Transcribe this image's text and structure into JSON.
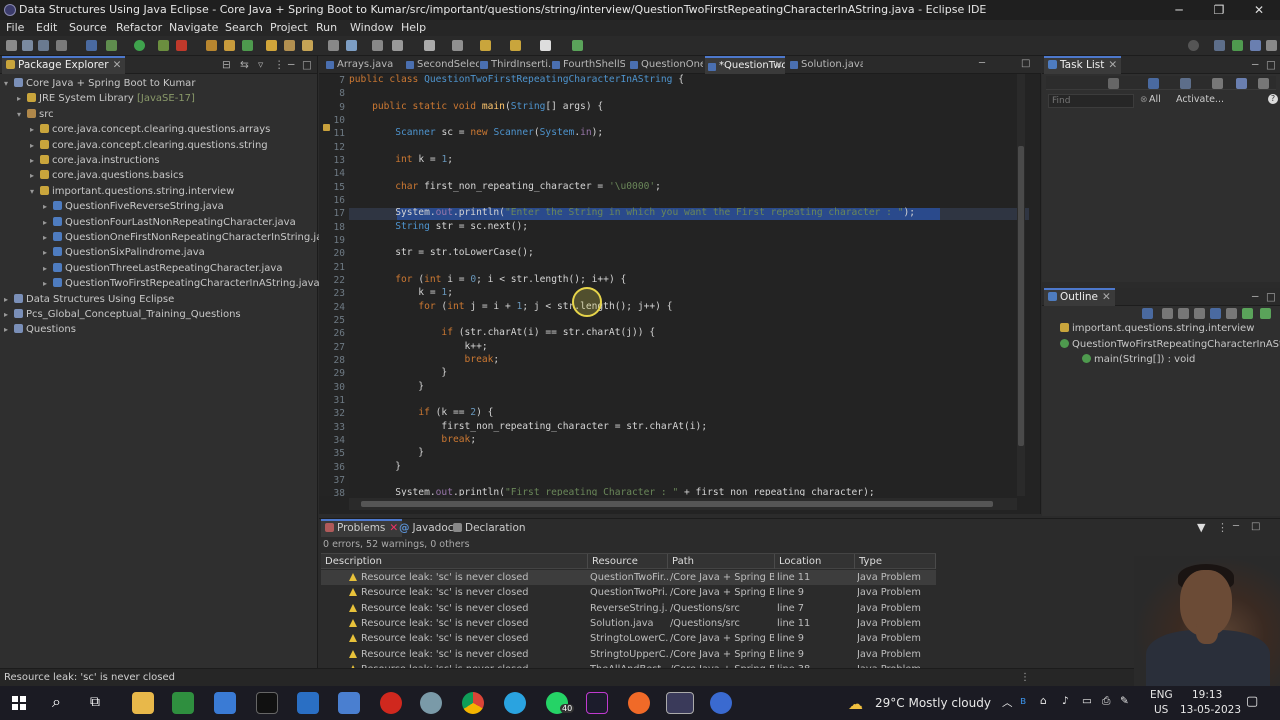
{
  "window": {
    "title": "Data Structures Using Java  Eclipse - Core Java + Spring Boot to Kumar/src/important/questions/string/interview/QuestionTwoFirstRepeatingCharacterInAString.java - Eclipse IDE",
    "minimize": "─",
    "maximize": "❐",
    "close": "✕"
  },
  "menu": [
    "File",
    "Edit",
    "Source",
    "Refactor",
    "Navigate",
    "Search",
    "Project",
    "Run",
    "Window",
    "Help"
  ],
  "package_explorer": {
    "tab_label": "Package Explorer",
    "tree": [
      {
        "label": "Core Java + Spring Boot to Kumar",
        "indent": 0,
        "twisty": "▾",
        "icon": "project-icon"
      },
      {
        "label": "JRE System Library",
        "suffix": " [JavaSE-17]",
        "indent": 1,
        "twisty": "▸",
        "icon": "library-icon"
      },
      {
        "label": "src",
        "indent": 1,
        "twisty": "▾",
        "icon": "source-folder-icon"
      },
      {
        "label": "core.java.concept.clearing.questions.arrays",
        "indent": 2,
        "twisty": "▸",
        "icon": "package-icon"
      },
      {
        "label": "core.java.concept.clearing.questions.string",
        "indent": 2,
        "twisty": "▸",
        "icon": "package-icon"
      },
      {
        "label": "core.java.instructions",
        "indent": 2,
        "twisty": "▸",
        "icon": "package-icon"
      },
      {
        "label": "core.java.questions.basics",
        "indent": 2,
        "twisty": "▸",
        "icon": "package-icon"
      },
      {
        "label": "important.questions.string.interview",
        "indent": 2,
        "twisty": "▾",
        "icon": "package-icon"
      },
      {
        "label": "QuestionFiveReverseString.java",
        "indent": 3,
        "twisty": "▸",
        "icon": "java-file-icon"
      },
      {
        "label": "QuestionFourLastNonRepeatingCharacter.java",
        "indent": 3,
        "twisty": "▸",
        "icon": "java-file-icon"
      },
      {
        "label": "QuestionOneFirstNonRepeatingCharacterInString.java",
        "indent": 3,
        "twisty": "▸",
        "icon": "java-file-icon"
      },
      {
        "label": "QuestionSixPalindrome.java",
        "indent": 3,
        "twisty": "▸",
        "icon": "java-file-icon"
      },
      {
        "label": "QuestionThreeLastRepeatingCharacter.java",
        "indent": 3,
        "twisty": "▸",
        "icon": "java-file-icon"
      },
      {
        "label": "QuestionTwoFirstRepeatingCharacterInAString.java",
        "indent": 3,
        "twisty": "▸",
        "icon": "java-file-icon"
      },
      {
        "label": "Data Structures Using Eclipse",
        "indent": 0,
        "twisty": "▸",
        "icon": "project-icon"
      },
      {
        "label": "Pcs_Global_Conceptual_Training_Questions",
        "indent": 0,
        "twisty": "▸",
        "icon": "project-icon"
      },
      {
        "label": "Questions",
        "indent": 0,
        "twisty": "▸",
        "icon": "project-icon"
      }
    ]
  },
  "editor": {
    "tabs": [
      "Arrays.java",
      "SecondSelec...",
      "ThirdInserti...",
      "FourthShellS...",
      "QuestionOne...",
      "*QuestionTwo...",
      "Solution.java"
    ],
    "active_tab": 5,
    "line_numbers": [
      "7",
      "8",
      "9",
      "10",
      "11",
      "12",
      "13",
      "14",
      "15",
      "16",
      "17",
      "18",
      "19",
      "20",
      "21",
      "22",
      "23",
      "24",
      "25",
      "26",
      "27",
      "28",
      "29",
      "30",
      "31",
      "32",
      "33",
      "34",
      "35",
      "36",
      "37",
      "38"
    ],
    "code": [
      {
        "parts": [
          [
            "kw",
            "public class "
          ],
          [
            "cls",
            "QuestionTwoFirstRepeatingCharacterInAString"
          ],
          [
            "var",
            " {"
          ]
        ]
      },
      {
        "parts": []
      },
      {
        "parts": [
          [
            "var",
            "    "
          ],
          [
            "kw",
            "public static void "
          ],
          [
            "mth",
            "main"
          ],
          [
            "var",
            "("
          ],
          [
            "cls",
            "String"
          ],
          [
            "var",
            "[] args) {"
          ]
        ]
      },
      {
        "parts": []
      },
      {
        "parts": [
          [
            "var",
            "        "
          ],
          [
            "cls",
            "Scanner "
          ],
          [
            "var",
            "sc = "
          ],
          [
            "kw",
            "new "
          ],
          [
            "cls",
            "Scanner"
          ],
          [
            "var",
            "("
          ],
          [
            "cls",
            "System"
          ],
          [
            "var",
            "."
          ],
          [
            "fld",
            "in"
          ],
          [
            "var",
            ");"
          ]
        ]
      },
      {
        "parts": []
      },
      {
        "parts": [
          [
            "var",
            "        "
          ],
          [
            "kw",
            "int "
          ],
          [
            "var",
            "k = "
          ],
          [
            "num",
            "1"
          ],
          [
            "var",
            ";"
          ]
        ]
      },
      {
        "parts": []
      },
      {
        "parts": [
          [
            "var",
            "        "
          ],
          [
            "kw",
            "char "
          ],
          [
            "var",
            "first_non_repeating_character = "
          ],
          [
            "str",
            "'\\u0000'"
          ],
          [
            "var",
            ";"
          ]
        ]
      },
      {
        "parts": []
      },
      {
        "parts": [
          [
            "var",
            "        System."
          ],
          [
            "fld",
            "out"
          ],
          [
            "var",
            ".println("
          ],
          [
            "str",
            "\"Enter the String in which you want the First repeating character : \""
          ],
          [
            "var",
            ");"
          ]
        ]
      },
      {
        "parts": [
          [
            "var",
            "        "
          ],
          [
            "cls",
            "String "
          ],
          [
            "var",
            "str = sc.next();"
          ]
        ]
      },
      {
        "parts": []
      },
      {
        "parts": [
          [
            "var",
            "        str = str.toLowerCase();"
          ]
        ]
      },
      {
        "parts": []
      },
      {
        "parts": [
          [
            "var",
            "        "
          ],
          [
            "kw",
            "for "
          ],
          [
            "var",
            "("
          ],
          [
            "kw",
            "int "
          ],
          [
            "var",
            "i = "
          ],
          [
            "num",
            "0"
          ],
          [
            "var",
            "; i < str.length(); i++) {"
          ]
        ]
      },
      {
        "parts": [
          [
            "var",
            "            k = "
          ],
          [
            "num",
            "1"
          ],
          [
            "var",
            ";"
          ]
        ]
      },
      {
        "parts": [
          [
            "var",
            "            "
          ],
          [
            "kw",
            "for "
          ],
          [
            "var",
            "("
          ],
          [
            "kw",
            "int "
          ],
          [
            "var",
            "j = i + "
          ],
          [
            "num",
            "1"
          ],
          [
            "var",
            "; j < str.length(); j++) {"
          ]
        ]
      },
      {
        "parts": []
      },
      {
        "parts": [
          [
            "var",
            "                "
          ],
          [
            "kw",
            "if "
          ],
          [
            "var",
            "(str.charAt(i) == str.charAt(j)) {"
          ]
        ]
      },
      {
        "parts": [
          [
            "var",
            "                    k++;"
          ]
        ]
      },
      {
        "parts": [
          [
            "var",
            "                    "
          ],
          [
            "kw",
            "break"
          ],
          [
            "var",
            ";"
          ]
        ]
      },
      {
        "parts": [
          [
            "var",
            "                }"
          ]
        ]
      },
      {
        "parts": [
          [
            "var",
            "            }"
          ]
        ]
      },
      {
        "parts": []
      },
      {
        "parts": [
          [
            "var",
            "            "
          ],
          [
            "kw",
            "if "
          ],
          [
            "var",
            "(k == "
          ],
          [
            "num",
            "2"
          ],
          [
            "var",
            ") {"
          ]
        ]
      },
      {
        "parts": [
          [
            "var",
            "                first_non_repeating_character = str.charAt(i);"
          ]
        ]
      },
      {
        "parts": [
          [
            "var",
            "                "
          ],
          [
            "kw",
            "break"
          ],
          [
            "var",
            ";"
          ]
        ]
      },
      {
        "parts": [
          [
            "var",
            "            }"
          ]
        ]
      },
      {
        "parts": [
          [
            "var",
            "        }"
          ]
        ]
      },
      {
        "parts": []
      },
      {
        "parts": [
          [
            "var",
            "        System."
          ],
          [
            "fld",
            "out"
          ],
          [
            "var",
            ".println("
          ],
          [
            "str",
            "\"First repeating Character : \""
          ],
          [
            "var",
            " + first_non_repeating_character);"
          ]
        ]
      }
    ]
  },
  "task_list": {
    "tab_label": "Task List",
    "find_placeholder": "Find",
    "all_label": "All",
    "activate_label": "Activate..."
  },
  "outline": {
    "tab_label": "Outline",
    "items": [
      {
        "label": "important.questions.string.interview",
        "indent": 0
      },
      {
        "label": "QuestionTwoFirstRepeatingCharacterInAString",
        "indent": 0
      },
      {
        "label": "main(String[]) : void",
        "indent": 1
      }
    ]
  },
  "problems": {
    "tabs": [
      "Problems",
      "Javadoc",
      "Declaration"
    ],
    "summary": "0 errors, 52 warnings, 0 others",
    "columns": [
      "Description",
      "Resource",
      "Path",
      "Location",
      "Type"
    ],
    "rows": [
      [
        "Resource leak: 'sc' is never closed",
        "QuestionTwoFir...",
        "/Core Java + Spring B...",
        "line 11",
        "Java Problem"
      ],
      [
        "Resource leak: 'sc' is never closed",
        "QuestionTwoPri...",
        "/Core Java + Spring B...",
        "line 9",
        "Java Problem"
      ],
      [
        "Resource leak: 'sc' is never closed",
        "ReverseString.j...",
        "/Questions/src",
        "line 7",
        "Java Problem"
      ],
      [
        "Resource leak: 'sc' is never closed",
        "Solution.java",
        "/Questions/src",
        "line 11",
        "Java Problem"
      ],
      [
        "Resource leak: 'sc' is never closed",
        "StringtoLowerC...",
        "/Core Java + Spring B...",
        "line 9",
        "Java Problem"
      ],
      [
        "Resource leak: 'sc' is never closed",
        "StringtoUpperC...",
        "/Core Java + Spring B...",
        "line 9",
        "Java Problem"
      ],
      [
        "Resource leak: 'sc' is never closed",
        "TheAllAndBest...",
        "/Core Java + Spring B...",
        "line 38",
        "Java Problem"
      ]
    ]
  },
  "status": {
    "text": "Resource leak: 'sc' is never closed"
  },
  "taskbar": {
    "weather": "29°C  Mostly cloudy",
    "lang": "ENG",
    "region": "US",
    "time": "19:13",
    "date": "13-05-2023",
    "whatsapp_badge": "40"
  }
}
